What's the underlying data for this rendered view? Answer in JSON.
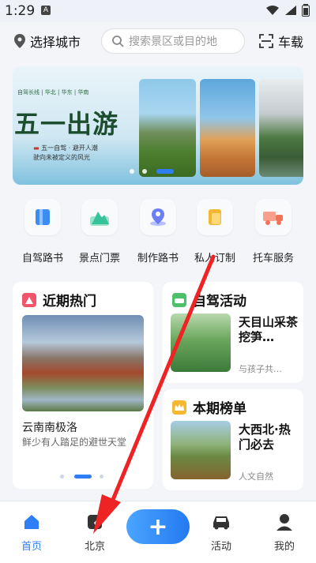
{
  "status_bar": {
    "time": "1:29",
    "badge": "A"
  },
  "header": {
    "city_label": "选择城市",
    "search_placeholder": "搜索景区或目的地",
    "car_label": "车载"
  },
  "banner": {
    "top_label": "自驾长线 | 华北 | 华东 | 华南",
    "title": "五一出游",
    "line1": "五一自驾 · 避开人潮",
    "line2": "驶向未被定义的风光"
  },
  "quick_links": [
    {
      "label": "自驾路书",
      "icon": "book-icon",
      "color": "#3d8df0"
    },
    {
      "label": "景点门票",
      "icon": "mountain-ticket-icon",
      "color": "#37c39a"
    },
    {
      "label": "制作路书",
      "icon": "map-pin-person-icon",
      "color": "#6b7ef5"
    },
    {
      "label": "私人订制",
      "icon": "custom-card-icon",
      "color": "#f5b632"
    },
    {
      "label": "托车服务",
      "icon": "truck-icon",
      "color": "#f2735a"
    }
  ],
  "hot": {
    "title": "近期热门",
    "place_name": "云南南极洛",
    "place_desc": "鲜少有人踏足的避世天堂"
  },
  "drive_activity": {
    "title": "自驾活动",
    "item_title": "天目山采茶挖笋…",
    "item_sub": "与孩子共…"
  },
  "ranking": {
    "title": "本期榜单",
    "item_title": "大西北·热门必去",
    "item_sub": "人文自然"
  },
  "bottom_nav": {
    "home": "首页",
    "city": "北京",
    "activity": "活动",
    "mine": "我的",
    "add": "+"
  }
}
